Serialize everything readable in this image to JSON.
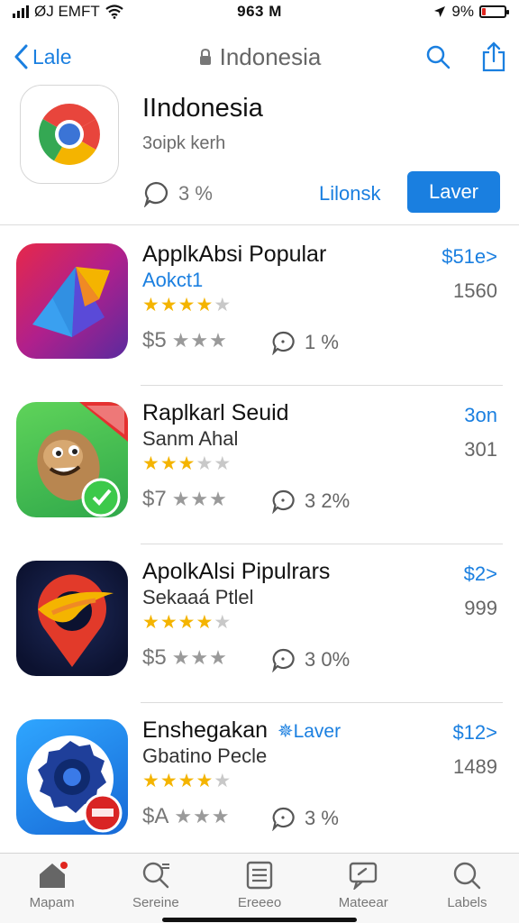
{
  "status_bar": {
    "carrier": "ØJ EMFT",
    "time": "963 M",
    "battery_text": "9%",
    "battery_level": 0.15,
    "battery_color": "#e0261f"
  },
  "nav": {
    "back_label": "Lale",
    "title": "Indonesia",
    "icons": [
      "chevron-left-icon",
      "lock-icon",
      "search-icon",
      "share-icon"
    ]
  },
  "header_app": {
    "title": "IIndonesia",
    "subtitle": "3oipk kerh",
    "stat": "3 %",
    "link_label": "Lilonsk",
    "button_label": "Laver",
    "icon": "chrome-icon"
  },
  "apps": [
    {
      "name": "ApplkAbsi Popular",
      "developer": "Aokct1",
      "developer_badge": "",
      "rating": 3.5,
      "price": "$5",
      "comments": "1 %",
      "action": "$51e>",
      "count": "1560",
      "icon": "folded-paper-icon"
    },
    {
      "name": "Raplkarl Seuid",
      "developer": "Sanm Ahal",
      "developer_badge": "",
      "rating": 3,
      "price": "$7",
      "comments": "3 2%",
      "action": "3on",
      "count": "301",
      "icon": "nut-mascot-icon"
    },
    {
      "name": "ApolkAlsi Pipulrars",
      "developer": "Sekaaá Ptlel",
      "developer_badge": "",
      "rating": 4,
      "price": "$5",
      "comments": "3 0%",
      "action": "$2>",
      "count": "999",
      "icon": "map-pin-icon"
    },
    {
      "name": "Enshegakan",
      "developer": "Gbatino Pecle",
      "developer_badge": "✵Laver",
      "rating": 4,
      "price": "$A",
      "comments": "3 %",
      "action": "$12>",
      "count": "1489",
      "icon": "camera-gear-icon"
    }
  ],
  "tabs": [
    {
      "label": "Mapam",
      "icon": "home-icon"
    },
    {
      "label": "Sereine",
      "icon": "search-tab-icon"
    },
    {
      "label": "Ereeeo",
      "icon": "list-icon"
    },
    {
      "label": "Mateear",
      "icon": "message-icon"
    },
    {
      "label": "Labels",
      "icon": "magnifier-icon"
    }
  ],
  "colors": {
    "accent": "#1a7fe0",
    "star": "#f4b400"
  }
}
